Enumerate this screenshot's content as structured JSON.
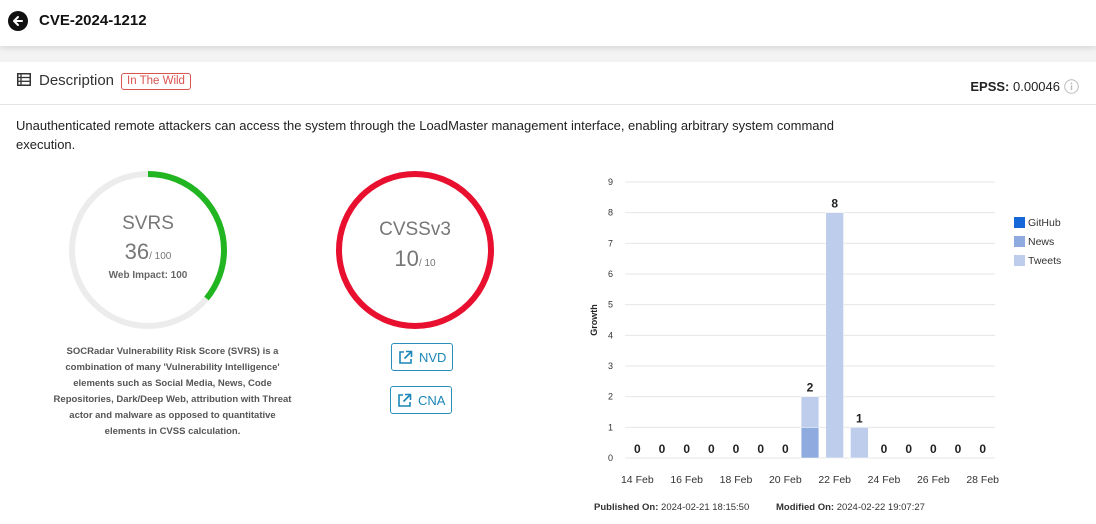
{
  "header": {
    "title": "CVE-2024-1212"
  },
  "description": {
    "title": "Description",
    "badge": "In The Wild",
    "epss_label": "EPSS:",
    "epss_value": "0.00046",
    "text": "Unauthenticated remote attackers can access the system through the LoadMaster management interface, enabling arbitrary system command execution."
  },
  "svrs": {
    "title": "SVRS",
    "score": "36",
    "max": "/ 100",
    "score_value": 36,
    "web_impact": "Web Impact: 100",
    "note": "SOCRadar Vulnerability Risk Score (SVRS) is a combination of many 'Vulnerability Intelligence' elements such as Social Media, News, Code Repositories, Dark/Deep Web, attribution with Threat actor and malware as opposed to quantitative elements in CVSS calculation.",
    "color": "#22b522"
  },
  "cvss": {
    "title": "CVSSv3",
    "score": "10",
    "max": "/ 10",
    "score_value": 10,
    "color": "#e8102e"
  },
  "links": {
    "nvd": "NVD",
    "cna": "CNA"
  },
  "meta": {
    "published_label": "Published On:",
    "published_value": "2024-02-21 18:15:50",
    "modified_label": "Modified On:",
    "modified_value": "2024-02-22 19:07:27"
  },
  "chart_data": {
    "type": "bar",
    "stacked": true,
    "ylabel": "Growth",
    "ylim": [
      0,
      9
    ],
    "yticks": [
      0,
      1,
      2,
      3,
      4,
      5,
      6,
      7,
      8,
      9
    ],
    "x_tick_labels": [
      "14 Feb",
      "16 Feb",
      "18 Feb",
      "20 Feb",
      "22 Feb",
      "24 Feb",
      "26 Feb",
      "28 Feb"
    ],
    "categories": [
      "2024-02-14",
      "2024-02-15",
      "2024-02-16",
      "2024-02-17",
      "2024-02-18",
      "2024-02-19",
      "2024-02-20",
      "2024-02-21",
      "2024-02-22",
      "2024-02-23",
      "2024-02-24",
      "2024-02-25",
      "2024-02-26",
      "2024-02-27",
      "2024-02-28"
    ],
    "totals": [
      0,
      0,
      0,
      0,
      0,
      0,
      0,
      2,
      8,
      1,
      0,
      0,
      0,
      0,
      0
    ],
    "series": [
      {
        "name": "GitHub",
        "color": "#1668d8",
        "values": [
          0,
          0,
          0,
          0,
          0,
          0,
          0,
          0,
          0,
          0,
          0,
          0,
          0,
          0,
          0
        ]
      },
      {
        "name": "News",
        "color": "#8eaadf",
        "values": [
          0,
          0,
          0,
          0,
          0,
          0,
          0,
          1,
          0,
          0,
          0,
          0,
          0,
          0,
          0
        ]
      },
      {
        "name": "Tweets",
        "color": "#bdcdeb",
        "values": [
          0,
          0,
          0,
          0,
          0,
          0,
          0,
          1,
          8,
          1,
          0,
          0,
          0,
          0,
          0
        ]
      }
    ],
    "grid": true,
    "legend": "right"
  }
}
